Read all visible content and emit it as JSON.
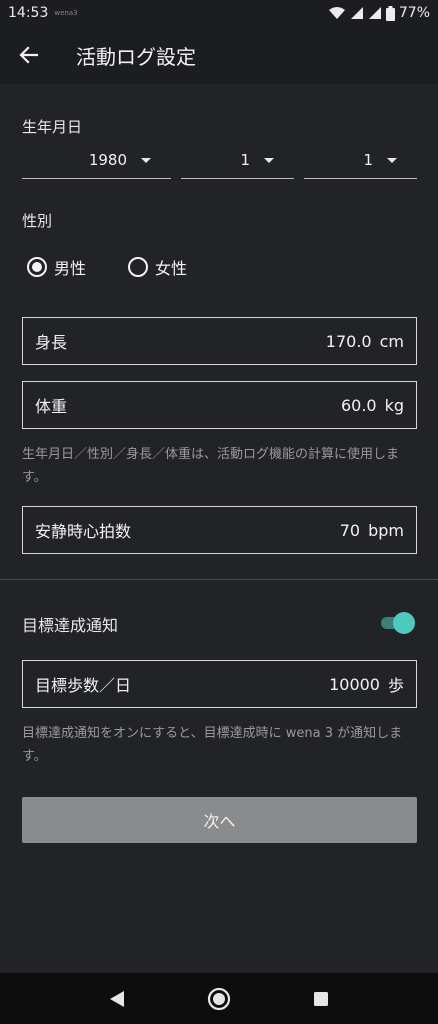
{
  "status_bar": {
    "time": "14:53",
    "tiny_label": "wena3",
    "battery": "77%"
  },
  "app_bar": {
    "title": "活動ログ設定",
    "back_icon": "arrow-left-icon"
  },
  "birthdate": {
    "label": "生年月日",
    "year": "1980",
    "month": "1",
    "day": "1"
  },
  "gender": {
    "label": "性別",
    "options": [
      {
        "label": "男性",
        "selected": true
      },
      {
        "label": "女性",
        "selected": false
      }
    ]
  },
  "height": {
    "label": "身長",
    "value": "170.0",
    "unit": "cm"
  },
  "weight": {
    "label": "体重",
    "value": "60.0",
    "unit": "kg"
  },
  "body_note": "生年月日／性別／身長／体重は、活動ログ機能の計算に使用します。",
  "resting_hr": {
    "label": "安静時心拍数",
    "value": "70",
    "unit": "bpm"
  },
  "goal_notify": {
    "label": "目標達成通知",
    "enabled": true,
    "accent_color": "#4fc9bd"
  },
  "daily_steps": {
    "label": "目標歩数／日",
    "value": "10000",
    "unit": "歩"
  },
  "goal_note": "目標達成通知をオンにすると、目標達成時に wena 3 が通知します。",
  "next_button": {
    "label": "次へ"
  },
  "nav": {
    "back": "triangle-back-icon",
    "home": "circle-home-icon",
    "recents": "square-recents-icon"
  }
}
